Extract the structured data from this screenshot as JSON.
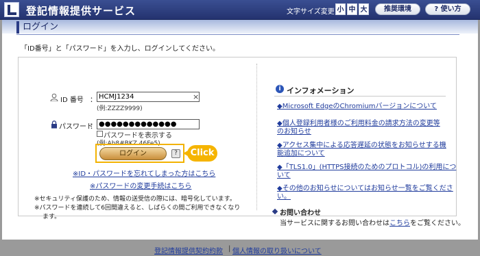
{
  "header": {
    "title": "登記情報提供サービス",
    "font_size_label": "文字サイズ変更",
    "font_sizes": [
      "小",
      "中",
      "大"
    ],
    "env_button": "推奨環境",
    "help_button": "? 使い方"
  },
  "login": {
    "heading": "ログイン",
    "instruction": "「ID番号」と「パスワード」を入力し、ログインしてください。",
    "id_label": "ID 番号",
    "id_value": "HCMJ1234",
    "id_example": "(例:ZZZZ9999)",
    "password_label": "パスワード",
    "password_value": "●●●●●●●●●●●●●",
    "show_password_label": "パスワードを表示する",
    "password_example": "(例:Ab8#BKZ 46Fe5)",
    "login_button": "ログイン",
    "help_icon": "?",
    "click_annotation": "Click",
    "forgot_link": "※ID・パスワードを忘れてしまった方はこちら",
    "change_password_link": "※パスワードの変更手続はこちら",
    "notes": [
      "※セキュリティ保護のため、情報の送受信の際には、暗号化しています。",
      "※パスワードを連続して6回間違えると、しばらくの間ご利用できなくなり",
      "ます。"
    ]
  },
  "info": {
    "title": "インフォメーション",
    "items": [
      [
        "◆Microsoft EdgeのChromiumバージョンについて"
      ],
      [
        "◆個人登録利用者様のご利用料金の請求方法の変更等",
        "のお知らせ"
      ],
      [
        "◆アクセス集中による応答遅延の状態をお知らせする機",
        "能追加について"
      ],
      [
        "◆「TLS1.0」(HTTPS接続のためのプロトコル)の利用につ",
        "いて"
      ],
      [
        "◆その他のお知らせについてはお知らせ一覧をご覧くださ",
        "い。"
      ]
    ],
    "contact_title": "お問い合わせ",
    "contact_prefix": "当サービスに関するお問い合わせは",
    "contact_link": "こちら",
    "contact_suffix": "をご覧ください。"
  },
  "footer": {
    "terms": "登記情報提供契約約款",
    "separator": "|",
    "privacy": "個人情報の取り扱いについて"
  },
  "colors": {
    "header_bg": "#24336f",
    "link": "#1f3b9c",
    "highlight": "#f2b200",
    "click_bubble": "#f5b400"
  }
}
